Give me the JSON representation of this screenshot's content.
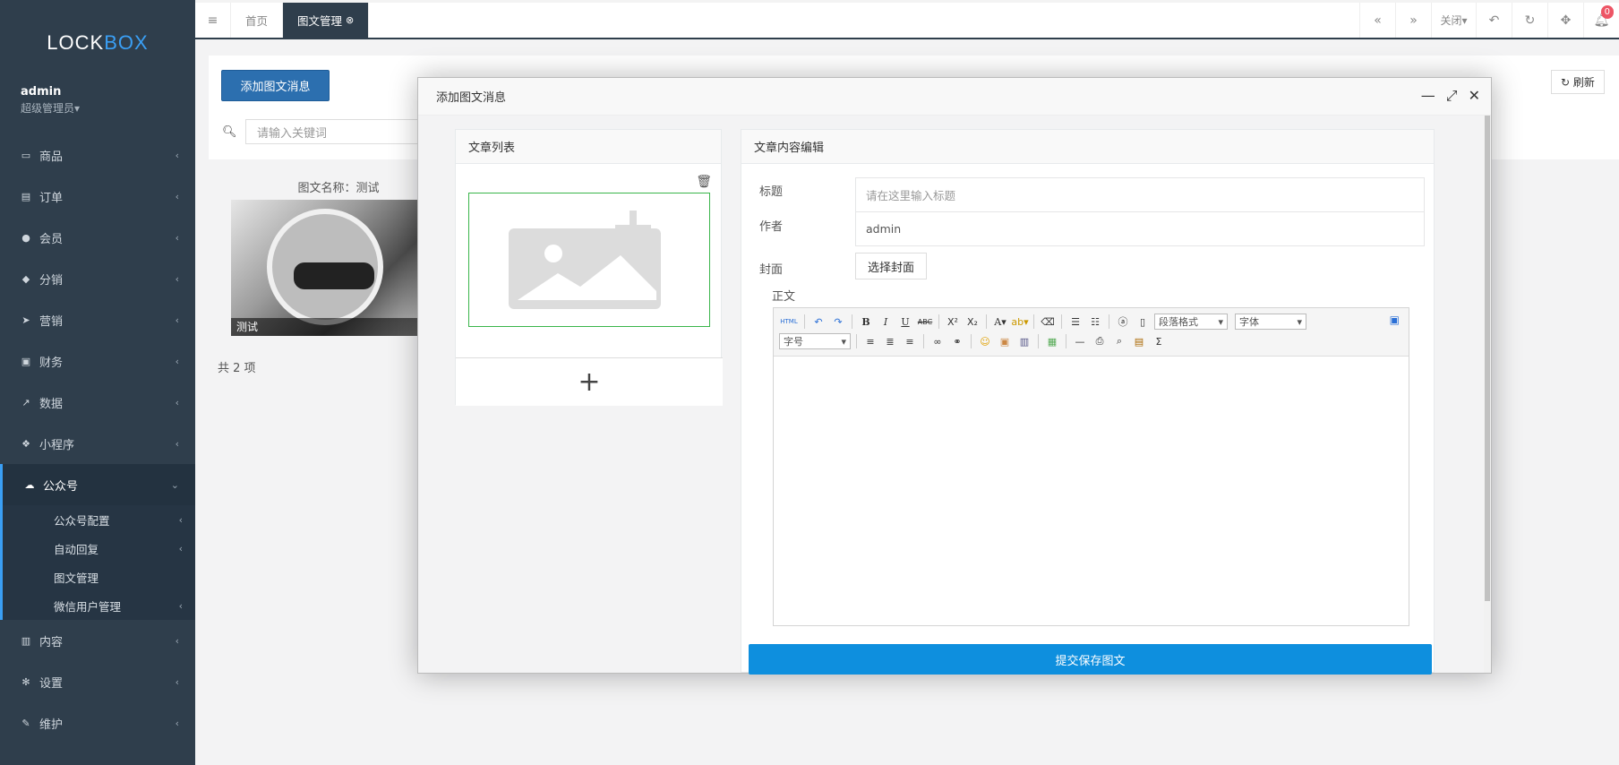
{
  "sidebar": {
    "logo_a": "LOCK",
    "logo_b": "BOX",
    "user_name": "admin",
    "user_role": "超级管理员▾",
    "items": [
      {
        "label": "商品",
        "icon": "monitor-icon"
      },
      {
        "label": "订单",
        "icon": "order-icon"
      },
      {
        "label": "会员",
        "icon": "user-icon"
      },
      {
        "label": "分销",
        "icon": "group-icon"
      },
      {
        "label": "营销",
        "icon": "send-icon"
      },
      {
        "label": "财务",
        "icon": "money-icon"
      },
      {
        "label": "数据",
        "icon": "chart-icon"
      },
      {
        "label": "小程序",
        "icon": "cubes-icon"
      },
      {
        "label": "公众号",
        "icon": "wechat-icon"
      },
      {
        "label": "内容",
        "icon": "book-icon"
      },
      {
        "label": "设置",
        "icon": "gear-icon"
      },
      {
        "label": "维护",
        "icon": "wrench-icon"
      }
    ],
    "sub_items": [
      {
        "label": "公众号配置"
      },
      {
        "label": "自动回复"
      },
      {
        "label": "图文管理"
      },
      {
        "label": "微信用户管理"
      }
    ]
  },
  "topbar": {
    "tab_home": "首页",
    "tab_active": "图文管理",
    "close_label": "关闭▾",
    "badge": "0"
  },
  "content": {
    "add_button": "添加图文消息",
    "refresh_button": "刷新",
    "search_placeholder": "请输入关键词",
    "card_title": "图文名称：测试",
    "card_caption": "测试",
    "total": "共 2 项"
  },
  "modal": {
    "title": "添加图文消息",
    "list_title": "文章列表",
    "edit_title": "文章内容编辑",
    "title_label": "标题",
    "title_placeholder": "请在这里输入标题",
    "author_label": "作者",
    "author_value": "admin",
    "cover_label": "封面",
    "cover_button": "选择封面",
    "body_label": "正文",
    "para_format": "段落格式",
    "font_family": "字体",
    "font_size": "字号",
    "submit_button": "提交保存图文",
    "add_article": "+"
  }
}
